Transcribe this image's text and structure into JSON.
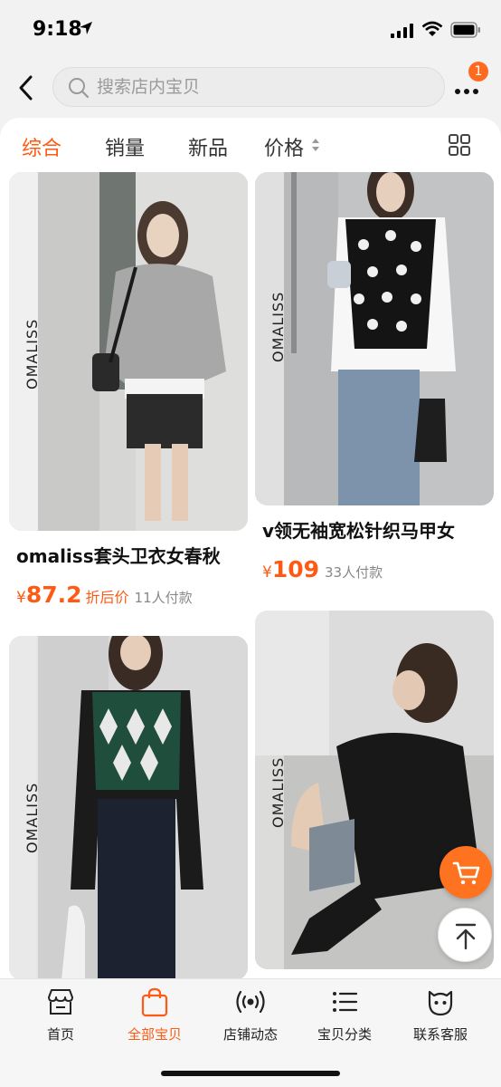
{
  "status_bar": {
    "time": "9:18"
  },
  "search": {
    "placeholder": "搜索店内宝贝"
  },
  "header": {
    "badge_count": "1"
  },
  "sort_tabs": [
    {
      "label": "综合",
      "active": true
    },
    {
      "label": "销量",
      "active": false
    },
    {
      "label": "新品",
      "active": false
    },
    {
      "label": "价格",
      "active": false
    }
  ],
  "products": [
    {
      "brand": "OMALISS",
      "title": "omaliss套头卫衣女春秋",
      "price_symbol": "¥",
      "price": "87.2",
      "price_tag": "折后价",
      "sold": "11人付款"
    },
    {
      "brand": "OMALISS",
      "title": "v领无袖宽松针织马甲女",
      "price_symbol": "¥",
      "price": "109",
      "price_tag": "",
      "sold": "33人付款"
    },
    {
      "brand": "OMALISS"
    },
    {
      "brand": "OMALISS"
    }
  ],
  "bottom_nav": [
    {
      "label": "首页",
      "icon": "storefront-icon",
      "active": false
    },
    {
      "label": "全部宝贝",
      "icon": "shopping-bag-icon",
      "active": true
    },
    {
      "label": "店铺动态",
      "icon": "broadcast-icon",
      "active": false
    },
    {
      "label": "宝贝分类",
      "icon": "list-icon",
      "active": false
    },
    {
      "label": "联系客服",
      "icon": "chat-face-icon",
      "active": false
    }
  ],
  "colors": {
    "accent": "#ff5a14",
    "badge": "#ff6a21",
    "cart_fab": "#ff7320"
  }
}
